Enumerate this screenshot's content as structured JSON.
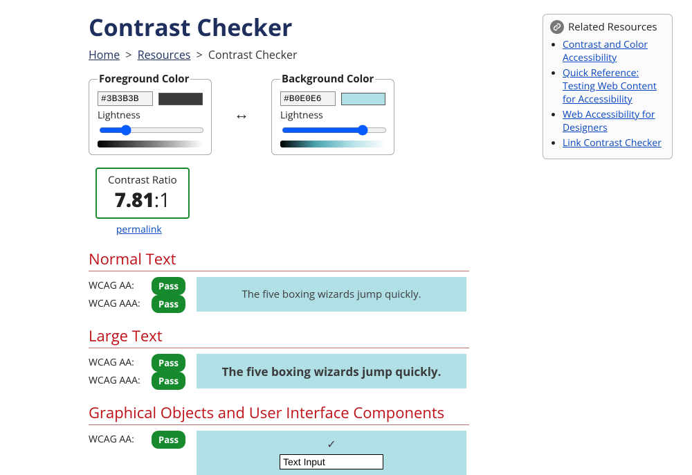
{
  "title": "Contrast Checker",
  "breadcrumb": {
    "home": "Home",
    "resources": "Resources",
    "current": "Contrast Checker"
  },
  "foreground": {
    "legend": "Foreground Color",
    "hex": "#3B3B3B",
    "lightness_label": "Lightness",
    "lightness": 23
  },
  "background": {
    "legend": "Background Color",
    "hex": "#B0E0E6",
    "lightness_label": "Lightness",
    "lightness": 80
  },
  "swap": "↔",
  "ratio": {
    "label": "Contrast Ratio",
    "value": "7.81",
    "suffix": ":1",
    "permalink": "permalink"
  },
  "sections": {
    "normal": {
      "heading": "Normal Text",
      "aa_label": "WCAG AA:",
      "aa_result": "Pass",
      "aaa_label": "WCAG AAA:",
      "aaa_result": "Pass",
      "sample": "The five boxing wizards jump quickly."
    },
    "large": {
      "heading": "Large Text",
      "aa_label": "WCAG AA:",
      "aa_result": "Pass",
      "aaa_label": "WCAG AAA:",
      "aaa_result": "Pass",
      "sample": "The five boxing wizards jump quickly."
    },
    "ui": {
      "heading": "Graphical Objects and User Interface Components",
      "aa_label": "WCAG AA:",
      "aa_result": "Pass",
      "check": "✓",
      "input_value": "Text Input"
    }
  },
  "aside": {
    "title": "Related Resources",
    "links": [
      "Contrast and Color Accessibility",
      "Quick Reference: Testing Web Content for Accessibility",
      "Web Accessibility for Designers",
      "Link Contrast Checker"
    ]
  }
}
